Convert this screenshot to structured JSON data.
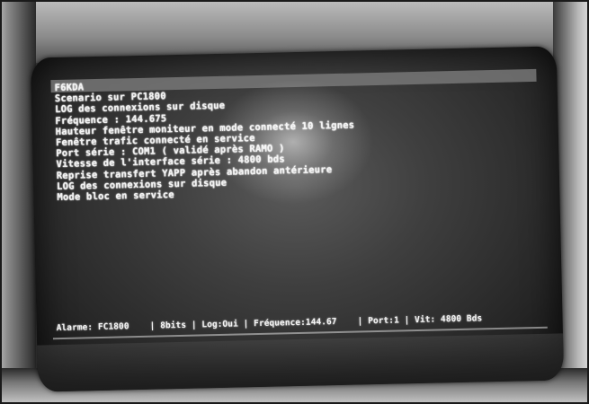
{
  "screen": {
    "lines": [
      "F6KDA",
      "Scenario sur PC1800",
      "LOG des connexions sur disque",
      "Fréquence : 144.675",
      "Hauteur fenêtre moniteur en mode connecté 10 lignes",
      "Fenêtre trafic connecté en service",
      "Port série : COM1 ( validé après RAMO )",
      "Vitesse de l'interface série : 4800 bds",
      "Reprise transfert YAPP après abandon antérieure",
      "LOG des connexions sur disque",
      "Mode bloc en service"
    ],
    "status_bar": {
      "text": "Alarme: FC1800    | 8bits | Log:Oui | Fréquence:144.67    | Port:1 | Vit: 4800 Bds"
    }
  }
}
